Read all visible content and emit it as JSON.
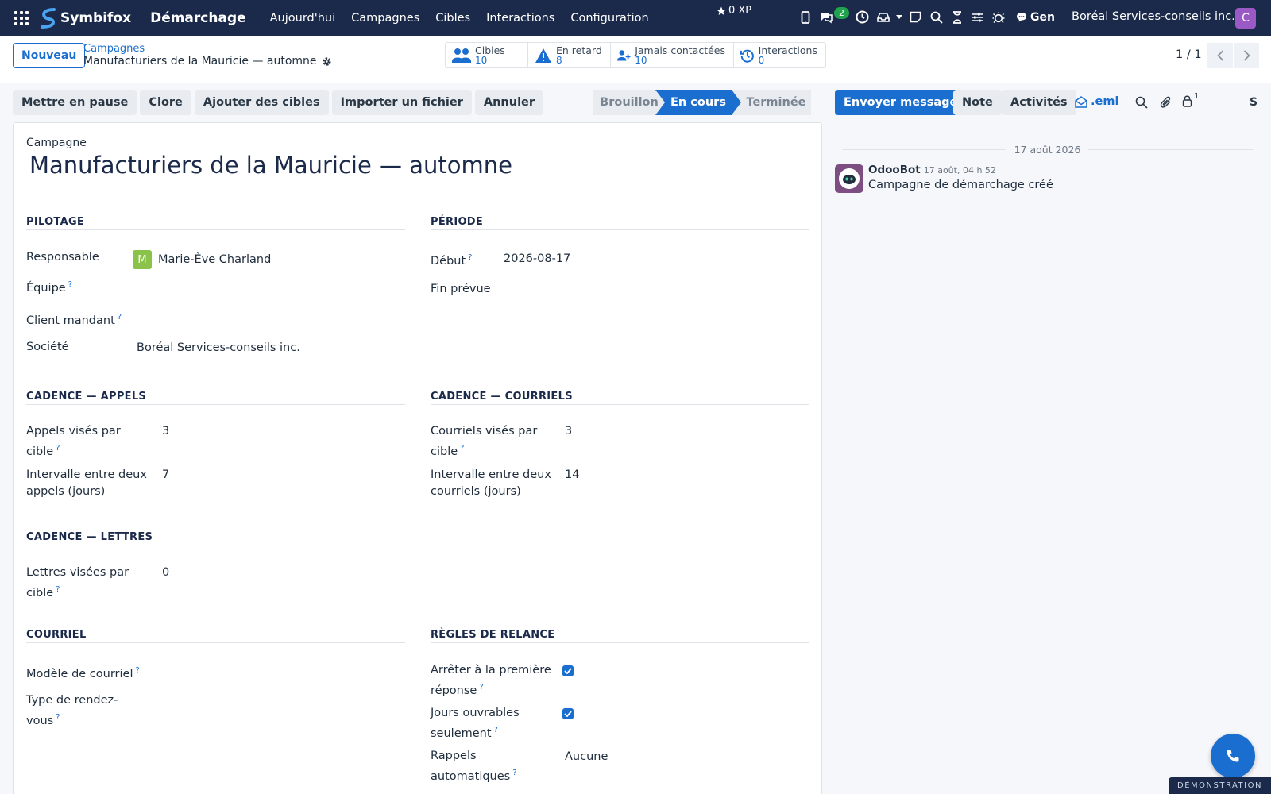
{
  "topbar": {
    "logo_text": "Symbifox",
    "app_name": "Démarchage",
    "menu": [
      "Aujourd'hui",
      "Campagnes",
      "Cibles",
      "Interactions",
      "Configuration"
    ],
    "xp": "0 XP",
    "messages_badge": "2",
    "gen_label": "Gen",
    "company": "Boréal Services-conseils inc.",
    "user_initial": "C"
  },
  "control": {
    "new_button": "Nouveau",
    "breadcrumb_parent": "Campagnes",
    "breadcrumb_current": "Manufacturiers de la Mauricie — automne",
    "stats": [
      {
        "label": "Cibles",
        "value": "10"
      },
      {
        "label": "En retard",
        "value": "8"
      },
      {
        "label": "Jamais contactées",
        "value": "10"
      },
      {
        "label": "Interactions",
        "value": "0"
      }
    ],
    "pager": "1 / 1"
  },
  "actions": [
    "Mettre en pause",
    "Clore",
    "Ajouter des cibles",
    "Importer un fichier",
    "Annuler"
  ],
  "stages": {
    "draft": "Brouillon",
    "running": "En cours",
    "done": "Terminée",
    "active": "En cours"
  },
  "form": {
    "record_label": "Campagne",
    "title": "Manufacturiers de la Mauricie — automne",
    "sections": {
      "pilotage": "PILOTAGE",
      "periode": "PÉRIODE",
      "appels": "CADENCE — APPELS",
      "courriels": "CADENCE — COURRIELS",
      "lettres": "CADENCE — LETTRES",
      "courriel": "COURRIEL",
      "relance": "RÈGLES DE RELANCE"
    },
    "labels": {
      "responsable": "Responsable",
      "equipe": "Équipe",
      "client": "Client mandant",
      "societe": "Société",
      "debut": "Début",
      "fin": "Fin prévue",
      "appels_vises": "Appels visés par cible",
      "intervalle_appels": "Intervalle entre deux appels (jours)",
      "courriels_vises": "Courriels visés par cible",
      "intervalle_courriels": "Intervalle entre deux courriels (jours)",
      "lettres_visees": "Lettres visées par cible",
      "modele_courriel": "Modèle de courriel",
      "type_rdv": "Type de rendez-vous",
      "arreter": "Arrêter à la première réponse",
      "jours_ouvrables": "Jours ouvrables seulement",
      "rappels": "Rappels automatiques"
    },
    "values": {
      "responsable_initial": "M",
      "responsable": "Marie-Ève Charland",
      "societe": "Boréal Services-conseils inc.",
      "debut": "2026-08-17",
      "appels_vises": "3",
      "intervalle_appels": "7",
      "courriels_vises": "3",
      "intervalle_courriels": "14",
      "lettres_visees": "0",
      "arreter": true,
      "jours_ouvrables": true,
      "rappels": "Aucune"
    }
  },
  "chatter": {
    "send_message": "Envoyer message",
    "note": "Note",
    "activities": "Activités",
    "eml": ".eml",
    "followers_count": "1",
    "s_label": "S",
    "date_separator": "17 août 2026",
    "author": "OdooBot",
    "timestamp": "17 août, 04 h 52",
    "message": "Campagne de démarchage créé"
  },
  "demo_banner": "DÉMONSTRATION",
  "colors": {
    "primary": "#1a6ecf",
    "navbar": "#1b2a4a",
    "avatar_user": "#9b59c6",
    "avatar_manager": "#8bc34a"
  }
}
